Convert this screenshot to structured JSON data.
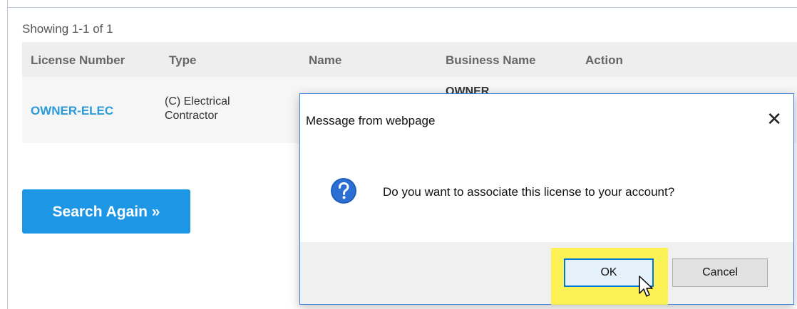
{
  "results": {
    "showing_text": "Showing 1-1 of 1",
    "columns": [
      "License Number",
      "Type",
      "Name",
      "Business Name",
      "Action"
    ],
    "rows": [
      {
        "license_number": "OWNER-ELEC",
        "type_line1": "(C) Electrical",
        "type_line2": "Contractor",
        "name": "",
        "business_name": "OWNER",
        "action": ""
      }
    ]
  },
  "search_again_label": "Search Again »",
  "dialog": {
    "title": "Message from webpage",
    "close_glyph": "✕",
    "message": "Do you want to associate this license to your account?",
    "icon": "question-icon",
    "ok_label": "OK",
    "cancel_label": "Cancel"
  },
  "colors": {
    "link": "#2a9ad8",
    "primary_button": "#1e96e6",
    "highlight": "#fff23a",
    "dialog_border": "#3c7fd6"
  }
}
